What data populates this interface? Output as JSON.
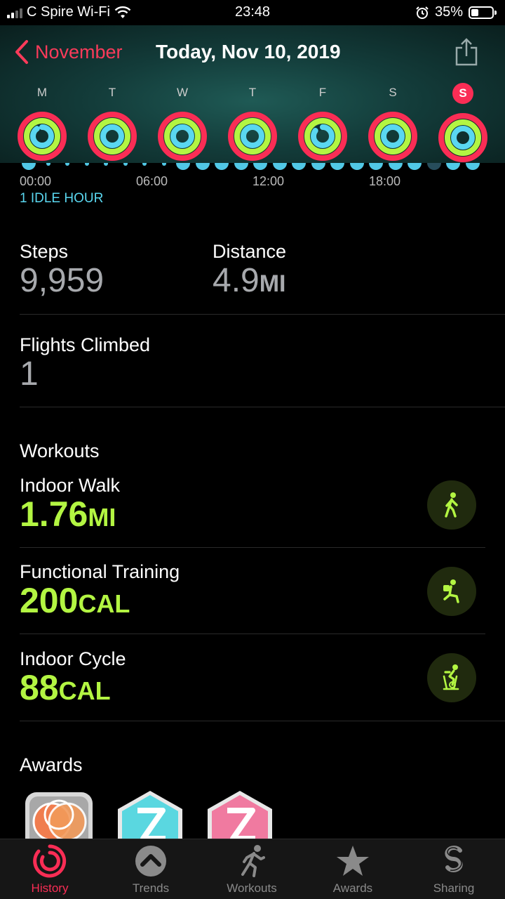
{
  "status_bar": {
    "carrier": "C Spire Wi-Fi",
    "time": "23:48",
    "battery": "35%",
    "battery_level": 0.35
  },
  "header": {
    "back_label": "November",
    "title": "Today, Nov 10, 2019"
  },
  "days": [
    "M",
    "T",
    "W",
    "T",
    "F",
    "S",
    "S"
  ],
  "timeline": {
    "ticks": [
      "00:00",
      "06:00",
      "12:00",
      "18:00"
    ],
    "idle_label": "1 IDLE HOUR"
  },
  "stats": {
    "steps_label": "Steps",
    "steps_value": "9,959",
    "distance_label": "Distance",
    "distance_value": "4.9",
    "distance_unit": "MI",
    "flights_label": "Flights Climbed",
    "flights_value": "1"
  },
  "workouts": {
    "title": "Workouts",
    "items": [
      {
        "name": "Indoor Walk",
        "value": "1.76",
        "unit": "MI",
        "icon": "walking-icon"
      },
      {
        "name": "Functional Training",
        "value": "200",
        "unit": "CAL",
        "icon": "functional-training-icon"
      },
      {
        "name": "Indoor Cycle",
        "value": "88",
        "unit": "CAL",
        "icon": "cycling-icon"
      }
    ]
  },
  "awards": {
    "title": "Awards"
  },
  "tabbar": [
    {
      "label": "History",
      "icon": "history-rings-icon",
      "active": true
    },
    {
      "label": "Trends",
      "icon": "trends-chevron-icon"
    },
    {
      "label": "Workouts",
      "icon": "running-figure-icon"
    },
    {
      "label": "Awards",
      "icon": "star-icon"
    },
    {
      "label": "Sharing",
      "icon": "sharing-s-icon"
    }
  ],
  "colors": {
    "move": "#fa2d55",
    "exercise": "#b3f542",
    "stand": "#5ad7f0",
    "accent": "#fa3b5a"
  }
}
